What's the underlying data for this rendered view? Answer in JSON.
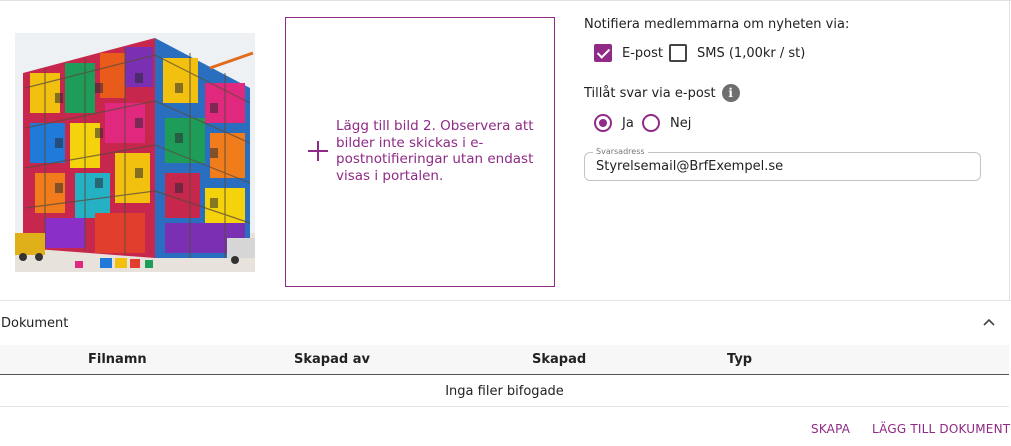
{
  "images": {
    "add_image_text": "Lägg till bild 2. Observera att bilder inte skickas i e-postnotifieringar utan endast visas i portalen."
  },
  "notify": {
    "title": "Notifiera medlemmarna om nyheten via:",
    "options": [
      {
        "label": "E-post",
        "checked": true
      },
      {
        "label": "SMS (1,00kr / st)",
        "checked": false
      }
    ]
  },
  "reply": {
    "title": "Tillåt svar via e-post",
    "info_icon": "i",
    "options": [
      {
        "label": "Ja",
        "selected": true
      },
      {
        "label": "Nej",
        "selected": false
      }
    ],
    "address_label": "Svarsadress",
    "address_value": "Styrelsemail@BrfExempel.se"
  },
  "documents": {
    "title": "Dokument",
    "columns": [
      "Filnamn",
      "Skapad av",
      "Skapad",
      "Typ"
    ],
    "empty_text": "Inga filer bifogade",
    "actions": {
      "create": "SKAPA",
      "add": "LÄGG TILL DOKUMENT"
    }
  },
  "colors": {
    "accent": "#8f2a86"
  }
}
